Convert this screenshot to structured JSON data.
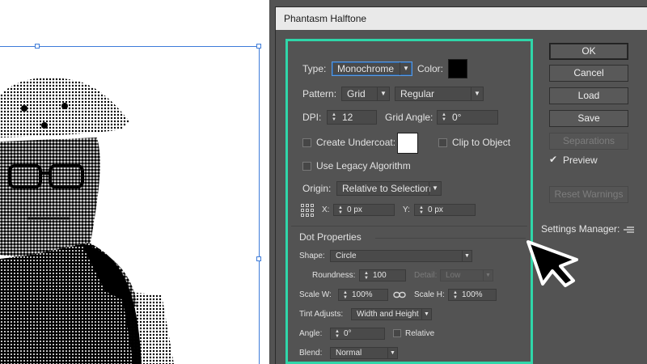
{
  "dialog": {
    "title": "Phantasm Halftone"
  },
  "settings": {
    "type_label": "Type:",
    "type_value": "Monochrome",
    "color_label": "Color:",
    "color_swatch": "#000000",
    "pattern_label": "Pattern:",
    "pattern_value": "Grid",
    "pattern_style_value": "Regular",
    "dpi_label": "DPI:",
    "dpi_value": "12",
    "grid_angle_label": "Grid Angle:",
    "grid_angle_value": "0°",
    "create_undercoat_label": "Create Undercoat:",
    "undercoat_swatch": "#ffffff",
    "clip_to_object_label": "Clip to Object",
    "use_legacy_label": "Use Legacy Algorithm",
    "origin_label": "Origin:",
    "origin_value": "Relative to Selection",
    "x_label": "X:",
    "x_value": "0 px",
    "y_label": "Y:",
    "y_value": "0 px"
  },
  "dot": {
    "section_title": "Dot Properties",
    "shape_label": "Shape:",
    "shape_value": "Circle",
    "roundness_label": "Roundness:",
    "roundness_value": "100",
    "detail_label": "Detail:",
    "detail_value": "Low",
    "scale_w_label": "Scale W:",
    "scale_w_value": "100%",
    "scale_h_label": "Scale H:",
    "scale_h_value": "100%",
    "tint_label": "Tint Adjusts:",
    "tint_value": "Width and Height",
    "angle_label": "Angle:",
    "angle_value": "0°",
    "relative_label": "Relative",
    "blend_label": "Blend:",
    "blend_value": "Normal"
  },
  "buttons": {
    "ok": "OK",
    "cancel": "Cancel",
    "load": "Load",
    "save": "Save",
    "separations": "Separations",
    "preview": "Preview",
    "reset_warnings": "Reset Warnings",
    "settings_manager": "Settings Manager:"
  },
  "colors": {
    "panel_highlight": "#2fd6a9",
    "dialog_bg": "#535353"
  }
}
